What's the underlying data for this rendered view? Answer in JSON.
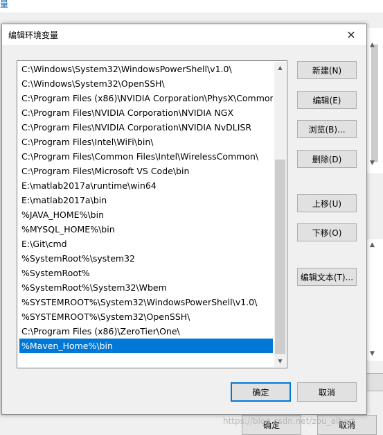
{
  "dialog": {
    "title": "编辑环境变量",
    "close_glyph": "✕",
    "paths": [
      "C:\\Windows\\System32\\WindowsPowerShell\\v1.0\\",
      "C:\\Windows\\System32\\OpenSSH\\",
      "C:\\Program Files (x86)\\NVIDIA Corporation\\PhysX\\Common",
      "C:\\Program Files\\NVIDIA Corporation\\NVIDIA NGX",
      "C:\\Program Files\\NVIDIA Corporation\\NVIDIA NvDLISR",
      "C:\\Program Files\\Intel\\WiFi\\bin\\",
      "C:\\Program Files\\Common Files\\Intel\\WirelessCommon\\",
      "C:\\Program Files\\Microsoft VS Code\\bin",
      "E:\\matlab2017a\\runtime\\win64",
      "E:\\matlab2017a\\bin",
      "%JAVA_HOME%\\bin",
      "%MYSQL_HOME%\\bin",
      "E:\\Git\\cmd",
      "%SystemRoot%\\system32",
      "%SystemRoot%",
      "%SystemRoot%\\System32\\Wbem",
      "%SYSTEMROOT%\\System32\\WindowsPowerShell\\v1.0\\",
      "%SYSTEMROOT%\\System32\\OpenSSH\\",
      "C:\\Program Files (x86)\\ZeroTier\\One\\",
      "%Maven_Home%\\bin"
    ],
    "selected_path": "%Maven_Home%\\bin",
    "buttons": {
      "new": "新建(N)",
      "edit": "编辑(E)",
      "browse": "浏览(B)...",
      "delete": "删除(D)",
      "move_up": "上移(U)",
      "move_down": "下移(O)",
      "edit_text": "编辑文本(T)...",
      "ok": "确定",
      "cancel": "取消"
    }
  },
  "background": {
    "ok": "确定",
    "cancel": "取消",
    "top_glyph": "量"
  },
  "watermark": "https://blog.csdn.net/zou_albert",
  "colors": {
    "selection": "#0078d7",
    "accent": "#0078d7"
  }
}
